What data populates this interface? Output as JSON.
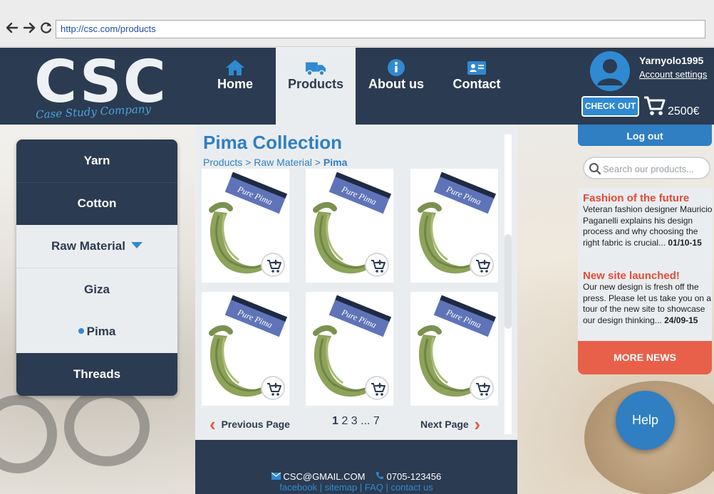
{
  "browser": {
    "url": "http://csc.com/products",
    "back_icon": "back-arrow-icon",
    "forward_icon": "forward-arrow-icon",
    "reload_icon": "reload-icon"
  },
  "logo": {
    "text": "CSC",
    "tagline": "Case Study Company"
  },
  "nav": {
    "tabs": [
      {
        "label": "Home",
        "icon": "home-icon"
      },
      {
        "label": "Products",
        "icon": "truck-icon",
        "active": true
      },
      {
        "label": "About us",
        "icon": "info-icon"
      },
      {
        "label": "Contact",
        "icon": "contact-card-icon"
      }
    ]
  },
  "account": {
    "username": "Yarnyolo1995",
    "settings_label": "Account settings",
    "checkout_label": "CHECK OUT",
    "cart_total": "2500€",
    "logout_label": "Log out"
  },
  "sidebar": {
    "items": [
      {
        "label": "Yarn"
      },
      {
        "label": "Cotton"
      },
      {
        "label": "Raw Material",
        "expanded": true
      },
      {
        "label": "Giza"
      },
      {
        "label": "Pima",
        "selected": true
      },
      {
        "label": "Threads"
      }
    ]
  },
  "main": {
    "title": "Pima Collection",
    "breadcrumb": [
      "Products",
      "Raw Material",
      "Pima"
    ],
    "breadcrumb_sep": " > ",
    "product_label": "Pure Pima",
    "product_count": 6
  },
  "pager": {
    "prev_label": "Previous Page",
    "next_label": "Next Page",
    "pages": [
      "1",
      "2",
      "3",
      "...",
      "7"
    ],
    "current": "1"
  },
  "footer": {
    "email": "CSC@GMAIL.COM",
    "phone": "0705-123456",
    "links": [
      "facebook",
      "sitemap",
      "FAQ",
      "contact us"
    ],
    "link_sep": " | "
  },
  "search": {
    "placeholder": "Search our products..."
  },
  "news": {
    "items": [
      {
        "title": "Fashion of the future",
        "body": "Veteran fashion designer Mauricio Paganelli explains his design process and why choosing the right fabric is crucial...",
        "date": "01/10-15"
      },
      {
        "title": "New site launched!",
        "body": "Our new design is fresh off the press. Please let us take you on a tour of the new site to showcase our design thinking...",
        "date": "24/09-15"
      }
    ],
    "more_label": "MORE NEWS"
  },
  "help": {
    "label": "Help"
  },
  "colors": {
    "navy": "#2b3b51",
    "blue": "#2f7fc2",
    "red": "#e44a35",
    "light": "#eaedf0"
  }
}
